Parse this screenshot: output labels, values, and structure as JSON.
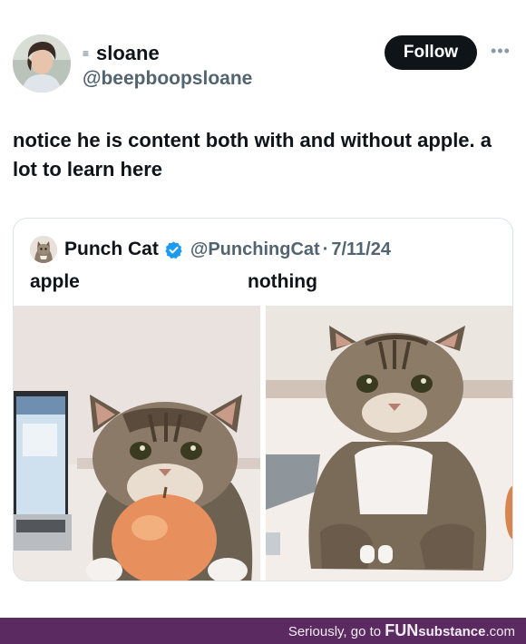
{
  "tweet": {
    "author": {
      "display_name": "sloane",
      "handle": "@beepboopsloane"
    },
    "follow_label": "Follow",
    "more_icon": "more-horizontal-icon",
    "text": "notice he is content both with and without apple. a lot to learn here"
  },
  "quote": {
    "author": {
      "display_name": "Punch Cat",
      "handle": "@PunchingCat",
      "verified": true
    },
    "separator": "·",
    "date": "7/11/24",
    "captions": {
      "left": "apple",
      "right": "nothing"
    }
  },
  "footer": {
    "prefix": "Seriously, go to ",
    "brand_strong": "FUN",
    "brand_rest": "substance",
    "suffix": ".com",
    "background": "#5a2a61"
  },
  "colors": {
    "follow_button": "#0f1419",
    "verified": "#1d9bf0",
    "secondary_text": "#536471"
  }
}
